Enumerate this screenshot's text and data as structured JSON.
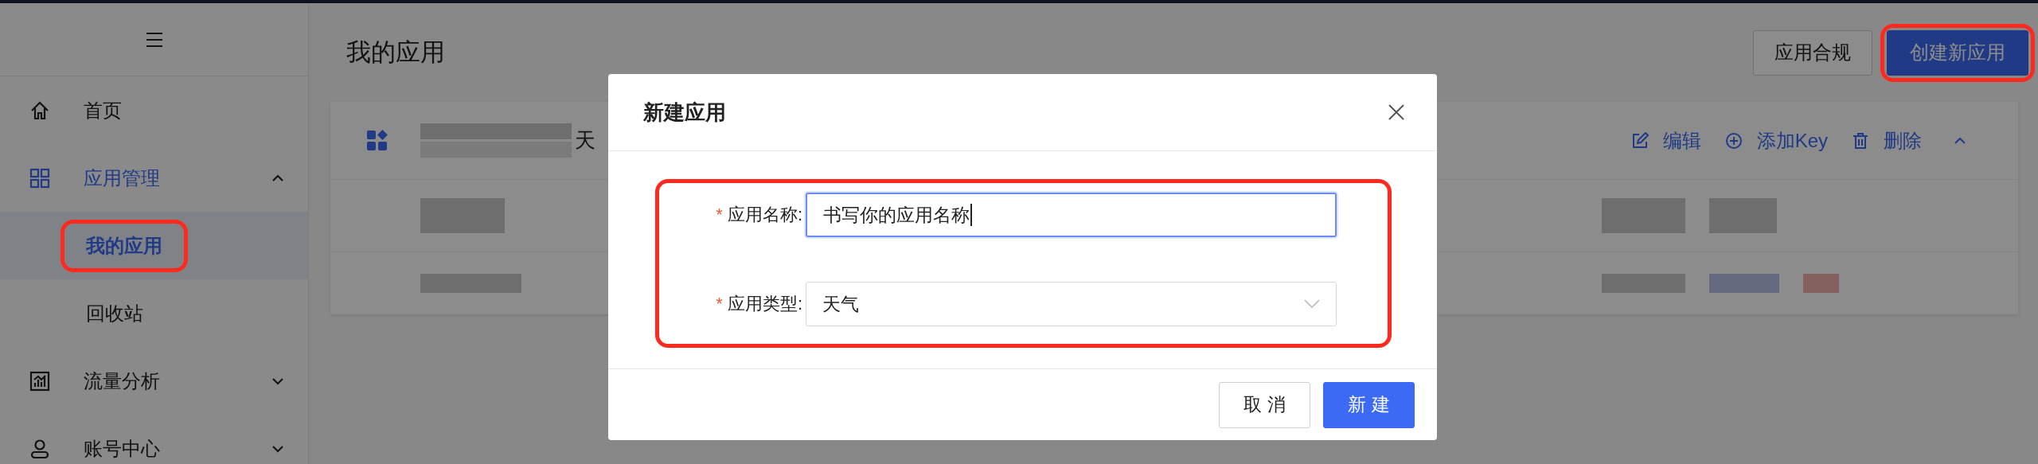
{
  "sidebar": {
    "items": [
      {
        "kind": "link",
        "label": "首页",
        "selected": false
      },
      {
        "kind": "group",
        "label": "应用管理",
        "expanded": true,
        "children": [
          {
            "label": "我的应用",
            "selected": true,
            "annotated": true
          },
          {
            "label": "回收站",
            "selected": false,
            "annotated": false
          }
        ]
      },
      {
        "kind": "group",
        "label": "流量分析",
        "expanded": false
      },
      {
        "kind": "group",
        "label": "账号中心",
        "expanded": false
      }
    ]
  },
  "header": {
    "title": "我的应用",
    "buttons": [
      {
        "label": "应用合规",
        "kind": "default",
        "annotated": false
      },
      {
        "label": "创建新应用",
        "kind": "primary",
        "annotated": true
      }
    ]
  },
  "card": {
    "type_text": "天",
    "expanded": true,
    "actions": [
      {
        "label": "编辑",
        "kind": "edit"
      },
      {
        "label": "添加Key",
        "kind": "add"
      },
      {
        "label": "删除",
        "kind": "delete"
      }
    ]
  },
  "dialog": {
    "title": "新建应用",
    "annotated": true,
    "fields": [
      {
        "mark": "*",
        "label": "应用名称:",
        "kind": "input",
        "value": "书写你的应用名称",
        "focused": true
      },
      {
        "mark": "*",
        "label": "应用类型:",
        "kind": "select",
        "value": "天气",
        "focused": false
      }
    ],
    "buttons": [
      {
        "label": "取 消",
        "kind": "default"
      },
      {
        "label": "新 建",
        "kind": "primary"
      }
    ]
  }
}
